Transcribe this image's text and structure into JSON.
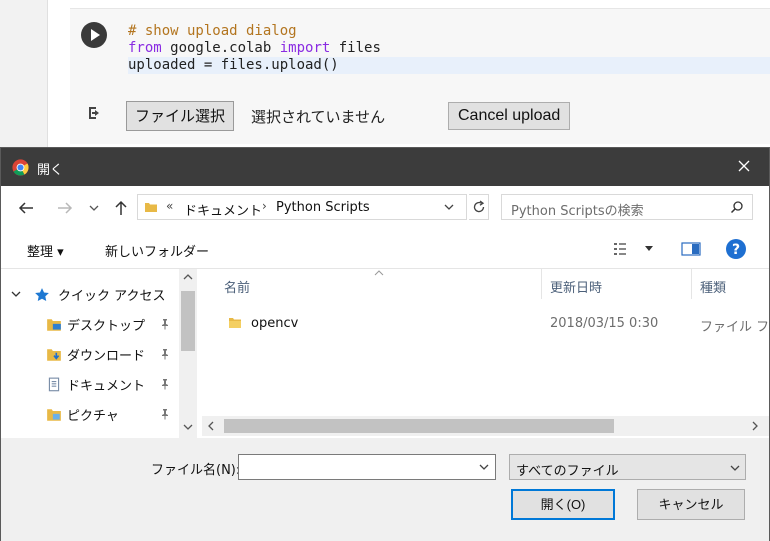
{
  "colab": {
    "code_lines": [
      {
        "parts": [
          {
            "t": "# show upload dialog",
            "c": "comment"
          }
        ]
      },
      {
        "parts": [
          {
            "t": "from",
            "c": "kw"
          },
          {
            "t": " google.colab ",
            "c": "plain"
          },
          {
            "t": "import",
            "c": "kw"
          },
          {
            "t": " files",
            "c": "plain"
          }
        ]
      },
      {
        "parts": [
          {
            "t": "uploaded = files.upload()",
            "c": "plain"
          }
        ]
      }
    ],
    "choose_file_label": "ファイル選択",
    "no_file_text": "選択されていません",
    "cancel_upload_label": "Cancel upload"
  },
  "dialog": {
    "title": "開く",
    "address": {
      "overflow": "«",
      "segments": [
        "ドキュメント",
        "Python Scripts"
      ]
    },
    "search_placeholder": "Python Scriptsの検索",
    "toolbar": {
      "organize": "整理 ▾",
      "new_folder": "新しいフォルダー"
    },
    "nav_items": [
      {
        "label": "クイック アクセス",
        "icon": "star-icon",
        "pinned": false
      },
      {
        "label": "デスクトップ",
        "icon": "desktop-folder-icon",
        "pinned": true
      },
      {
        "label": "ダウンロード",
        "icon": "download-folder-icon",
        "pinned": true
      },
      {
        "label": "ドキュメント",
        "icon": "documents-folder-icon",
        "pinned": true
      },
      {
        "label": "ピクチャ",
        "icon": "pictures-folder-icon",
        "pinned": true
      }
    ],
    "columns": [
      "名前",
      "更新日時",
      "種類"
    ],
    "files": [
      {
        "name": "opencv",
        "modified": "2018/03/15 0:30",
        "type": "ファイル フォ"
      }
    ],
    "filename_label": "ファイル名(N):",
    "filename_value": "",
    "filetype_value": "すべてのファイル",
    "open_label": "開く(O)",
    "cancel_label": "キャンセル"
  },
  "colors": {
    "accent": "#0078d7",
    "titlebar": "#3c3c3c",
    "help": "#1e6fd1"
  }
}
